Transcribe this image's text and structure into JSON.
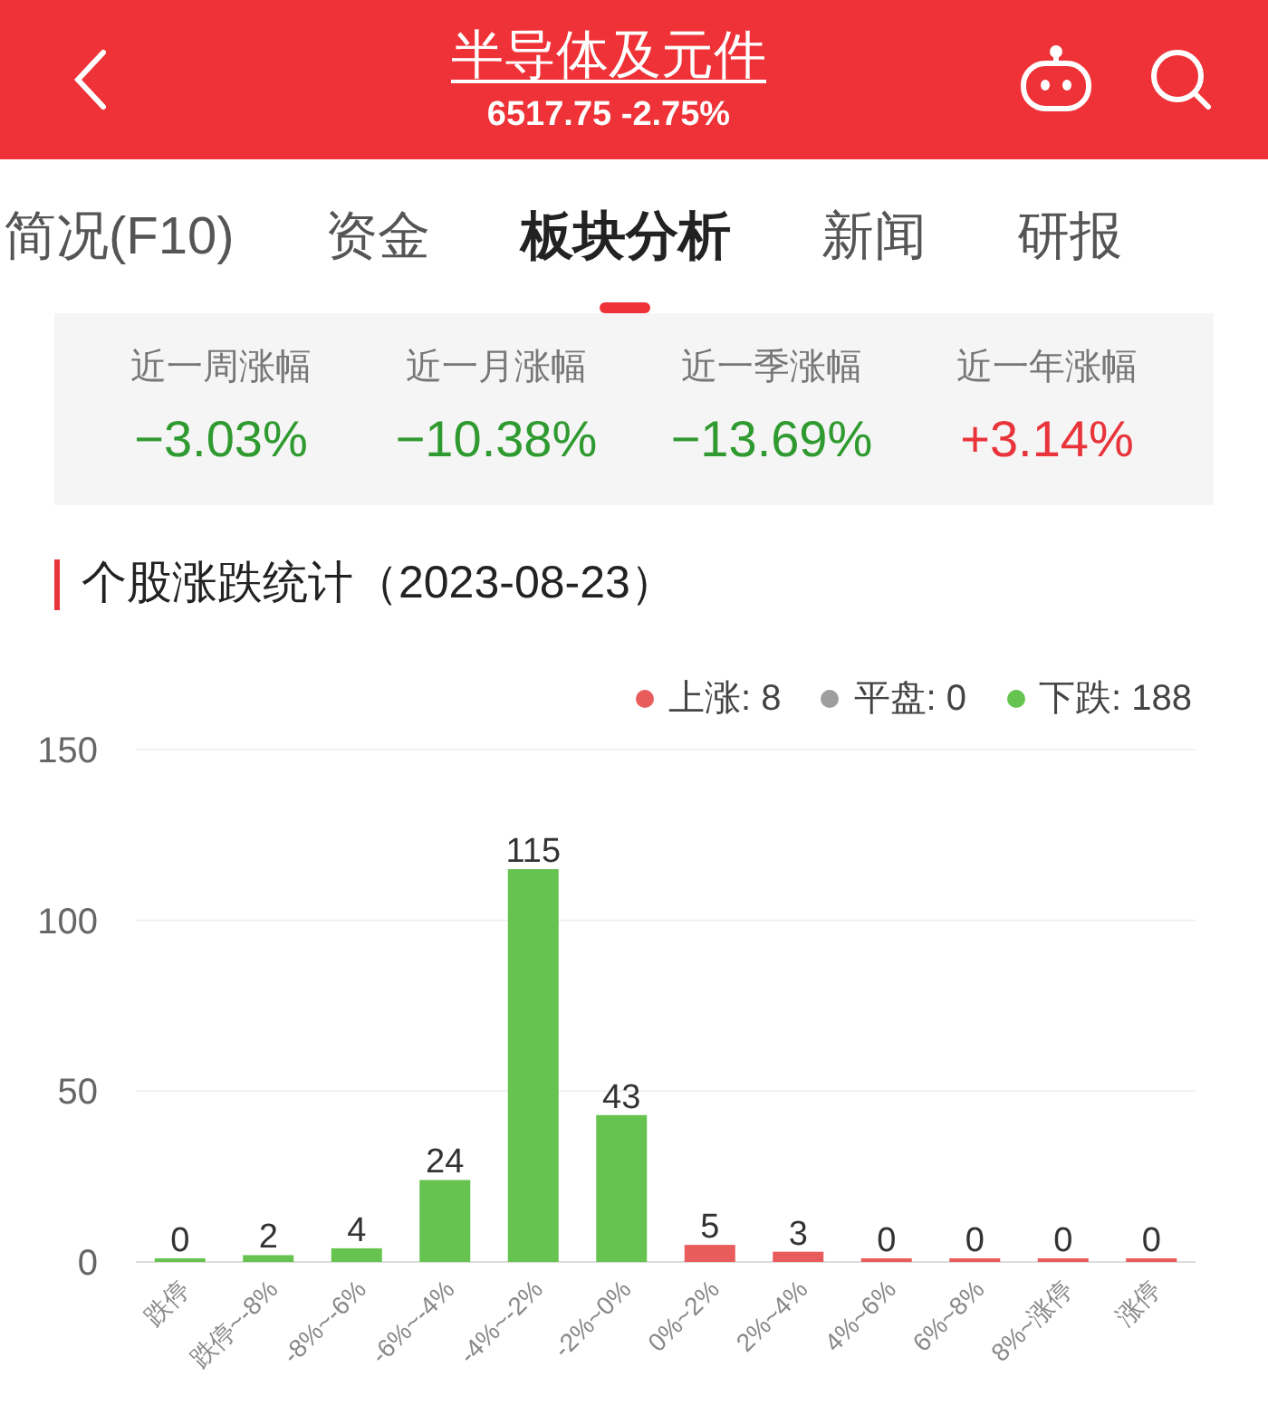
{
  "header": {
    "title": "半导体及元件",
    "quote": "6517.75 -2.75%"
  },
  "tabs": [
    {
      "label": "简况(F10)",
      "selected": false
    },
    {
      "label": "资金",
      "selected": false
    },
    {
      "label": "板块分析",
      "selected": true
    },
    {
      "label": "新闻",
      "selected": false
    },
    {
      "label": "研报",
      "selected": false
    }
  ],
  "performance": [
    {
      "label": "近一周涨幅",
      "value": "−3.03%",
      "color": "#2f9a2f"
    },
    {
      "label": "近一月涨幅",
      "value": "−10.38%",
      "color": "#2f9a2f"
    },
    {
      "label": "近一季涨幅",
      "value": "−13.69%",
      "color": "#2f9a2f"
    },
    {
      "label": "近一年涨幅",
      "value": "+3.14%",
      "color": "#e8343a"
    }
  ],
  "section_title": "个股涨跌统计（2023-08-23）",
  "legend": [
    {
      "label": "上涨: 8",
      "color": "#e85c5c"
    },
    {
      "label": "平盘: 0",
      "color": "#9e9e9e"
    },
    {
      "label": "下跌: 188",
      "color": "#66c34f"
    }
  ],
  "chart_data": {
    "type": "bar",
    "categories": [
      "跌停",
      "跌停~-8%",
      "-8%~-6%",
      "-6%~-4%",
      "-4%~-2%",
      "-2%~0%",
      "0%~2%",
      "2%~4%",
      "4%~6%",
      "6%~8%",
      "8%~涨停",
      "涨停"
    ],
    "series": [
      {
        "color": "#66c34f",
        "values": [
          0,
          2,
          4,
          24,
          115,
          43,
          null,
          null,
          null,
          null,
          null,
          null
        ]
      },
      {
        "color": "#e85c5c",
        "values": [
          null,
          null,
          null,
          null,
          null,
          null,
          5,
          3,
          0,
          0,
          0,
          0
        ]
      }
    ],
    "ylim": [
      0,
      150
    ],
    "yticks": [
      0,
      50,
      100,
      150
    ],
    "data_labels": true
  }
}
